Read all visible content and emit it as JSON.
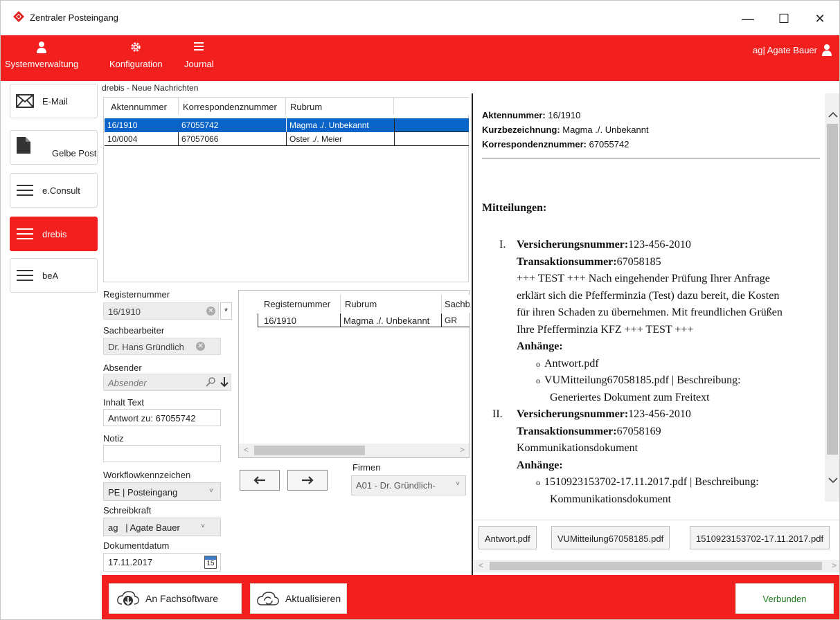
{
  "window": {
    "title": "Zentraler Posteingang",
    "minimize": "—",
    "maximize": "☐",
    "close": "✕"
  },
  "header": {
    "nav": [
      {
        "label": "Systemverwaltung"
      },
      {
        "label": "Konfiguration"
      },
      {
        "label": "Journal"
      }
    ],
    "user": "ag| Agate Bauer"
  },
  "sidebar": {
    "items": [
      {
        "label": "E-Mail"
      },
      {
        "label": "Gelbe Post"
      },
      {
        "label": "e.Consult"
      },
      {
        "label": "drebis"
      },
      {
        "label": "beA"
      }
    ]
  },
  "messages": {
    "title": "drebis - Neue Nachrichten",
    "columns": [
      "Aktennummer",
      "Korrespondenznummer",
      "Rubrum"
    ],
    "rows": [
      {
        "akte": "16/1910",
        "korr": "67055742",
        "rubrum": "Magma ./. Unbekannt"
      },
      {
        "akte": "10/0004",
        "korr": "67057066",
        "rubrum": "Oster ./. Meier"
      }
    ]
  },
  "form": {
    "registernummer_label": "Registernummer",
    "registernummer_value": "16/1910",
    "required_mark": "*",
    "sachbearbeiter_label": "Sachbearbeiter",
    "sachbearbeiter_value": "Dr. Hans Gründlich",
    "absender_label": "Absender",
    "absender_placeholder": "Absender",
    "inhalt_label": "Inhalt Text",
    "inhalt_value": "Antwort zu: 67055742",
    "notiz_label": "Notiz",
    "notiz_value": "",
    "workflow_label": "Workflowkennzeichen",
    "workflow_value": "PE  | Posteingang",
    "schreibkraft_label": "Schreibkraft",
    "schreibkraft_value": "ag   | Agate Bauer",
    "datum_label": "Dokumentdatum",
    "datum_value": "17.11.2017",
    "calendar_day": "15"
  },
  "register_grid": {
    "columns": [
      "Registernummer",
      "Rubrum",
      "Sachb"
    ],
    "rows": [
      {
        "nr": "16/1910",
        "rubrum": "Magma ./. Unbekannt",
        "sb": "GR"
      }
    ]
  },
  "firmen": {
    "label": "Firmen",
    "value": "A01 - Dr. Gründlich-"
  },
  "detail": {
    "akte_label": "Aktennummer:",
    "akte_value": "16/1910",
    "kurz_label": "Kurzbezeichnung:",
    "kurz_value": "Magma ./. Unbekannt",
    "korr_label": "Korrespondenznummer:",
    "korr_value": "67055742",
    "mitteilungen_heading": "Mitteilungen:",
    "items": [
      {
        "numeral": "I.",
        "vers_label": "Versicherungsnummer:",
        "vers_value": "123-456-2010",
        "trans_label": "Transaktionsummer:",
        "trans_value": "67058185",
        "text_lines": [
          "+++ TEST +++ Nach eingehender Prüfung Ihrer Anfrage",
          "erklärt sich die Pfefferminzia (Test) dazu bereit, die Kosten",
          "für ihren Schaden zu übernehmen. Mit freundlichen Grüßen",
          "Ihre Pfefferminzia KFZ +++ TEST +++"
        ],
        "anhaenge_label": "Anhänge:",
        "attachments": [
          "Antwort.pdf",
          "VUMitteilung67058185.pdf | Beschreibung:",
          "Generiertes Dokument zum Freitext"
        ]
      },
      {
        "numeral": "II.",
        "vers_label": "Versicherungsnummer:",
        "vers_value": "123-456-2010",
        "trans_label": "Transaktionsummer:",
        "trans_value": "67058169",
        "text_lines": [
          "Kommunikationsdokument"
        ],
        "anhaenge_label": "Anhänge:",
        "attachments": [
          "1510923153702-17.11.2017.pdf | Beschreibung:",
          "Kommunikationsdokument"
        ]
      }
    ],
    "attachment_buttons": [
      "Antwort.pdf",
      "VUMitteilung67058185.pdf",
      "1510923153702-17.11.2017.pdf"
    ]
  },
  "bottom": {
    "send_label": "An Fachsoftware",
    "refresh_label": "Aktualisieren",
    "status_label": "Verbunden"
  },
  "colors": {
    "accent": "#f21f1f",
    "selection": "#0a64c8",
    "status_text": "#1e7a1e"
  }
}
